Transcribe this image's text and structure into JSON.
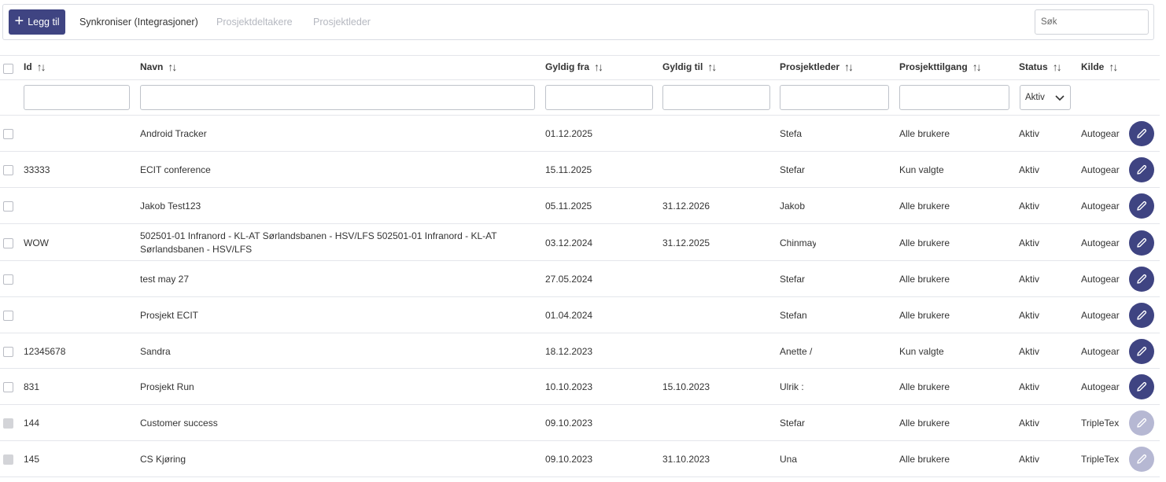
{
  "toolbar": {
    "add_label": "Legg til",
    "sync_label": "Synkroniser (Integrasjoner)",
    "participants_label": "Prosjektdeltakere",
    "leader_label": "Prosjektleder",
    "search_placeholder": "Søk"
  },
  "columns": {
    "id": "Id",
    "name": "Navn",
    "valid_from": "Gyldig fra",
    "valid_to": "Gyldig til",
    "leader": "Prosjektleder",
    "access": "Prosjekttilgang",
    "status": "Status",
    "source": "Kilde"
  },
  "filters": {
    "status_selected": "Aktiv"
  },
  "rows": [
    {
      "id": "",
      "name": "Android Tracker",
      "valid_from": "01.12.2025",
      "valid_to": "",
      "leader": "Stefa",
      "access": "Alle brukere",
      "status": "Aktiv",
      "source": "Autogear",
      "editable": true
    },
    {
      "id": "33333",
      "name": "ECIT conference",
      "valid_from": "15.11.2025",
      "valid_to": "",
      "leader": "Stefar",
      "access": "Kun valgte",
      "status": "Aktiv",
      "source": "Autogear",
      "editable": true
    },
    {
      "id": "",
      "name": "Jakob Test123",
      "valid_from": "05.11.2025",
      "valid_to": "31.12.2026",
      "leader": "Jakob",
      "access": "Alle brukere",
      "status": "Aktiv",
      "source": "Autogear",
      "editable": true
    },
    {
      "id": "WOW",
      "name": "502501-01 Infranord - KL-AT Sørlandsbanen - HSV/LFS 502501-01 Infranord - KL-AT Sørlandsbanen - HSV/LFS",
      "valid_from": "03.12.2024",
      "valid_to": "31.12.2025",
      "leader": "Chinmay",
      "access": "Alle brukere",
      "status": "Aktiv",
      "source": "Autogear",
      "editable": true
    },
    {
      "id": "",
      "name": "test may 27",
      "valid_from": "27.05.2024",
      "valid_to": "",
      "leader": "Stefar",
      "access": "Alle brukere",
      "status": "Aktiv",
      "source": "Autogear",
      "editable": true
    },
    {
      "id": "",
      "name": "Prosjekt ECIT",
      "valid_from": "01.04.2024",
      "valid_to": "",
      "leader": "Stefan",
      "access": "Alle brukere",
      "status": "Aktiv",
      "source": "Autogear",
      "editable": true
    },
    {
      "id": "12345678",
      "name": "Sandra",
      "valid_from": "18.12.2023",
      "valid_to": "",
      "leader": "Anette /",
      "access": "Kun valgte",
      "status": "Aktiv",
      "source": "Autogear",
      "editable": true
    },
    {
      "id": "831",
      "name": "Prosjekt Run",
      "valid_from": "10.10.2023",
      "valid_to": "15.10.2023",
      "leader": "Ulrik :",
      "access": "Alle brukere",
      "status": "Aktiv",
      "source": "Autogear",
      "editable": true
    },
    {
      "id": "144",
      "name": "Customer success",
      "valid_from": "09.10.2023",
      "valid_to": "",
      "leader": "Stefar",
      "access": "Alle brukere",
      "status": "Aktiv",
      "source": "TripleTex",
      "editable": false
    },
    {
      "id": "145",
      "name": "CS Kjøring",
      "valid_from": "09.10.2023",
      "valid_to": "31.10.2023",
      "leader": "Una",
      "access": "Alle brukere",
      "status": "Aktiv",
      "source": "TripleTex",
      "editable": false
    }
  ],
  "colors": {
    "primary": "#3f4482",
    "primary_disabled": "#b6b8d3",
    "border": "#e4e6eb",
    "disabled_text": "#b5b8c0"
  }
}
